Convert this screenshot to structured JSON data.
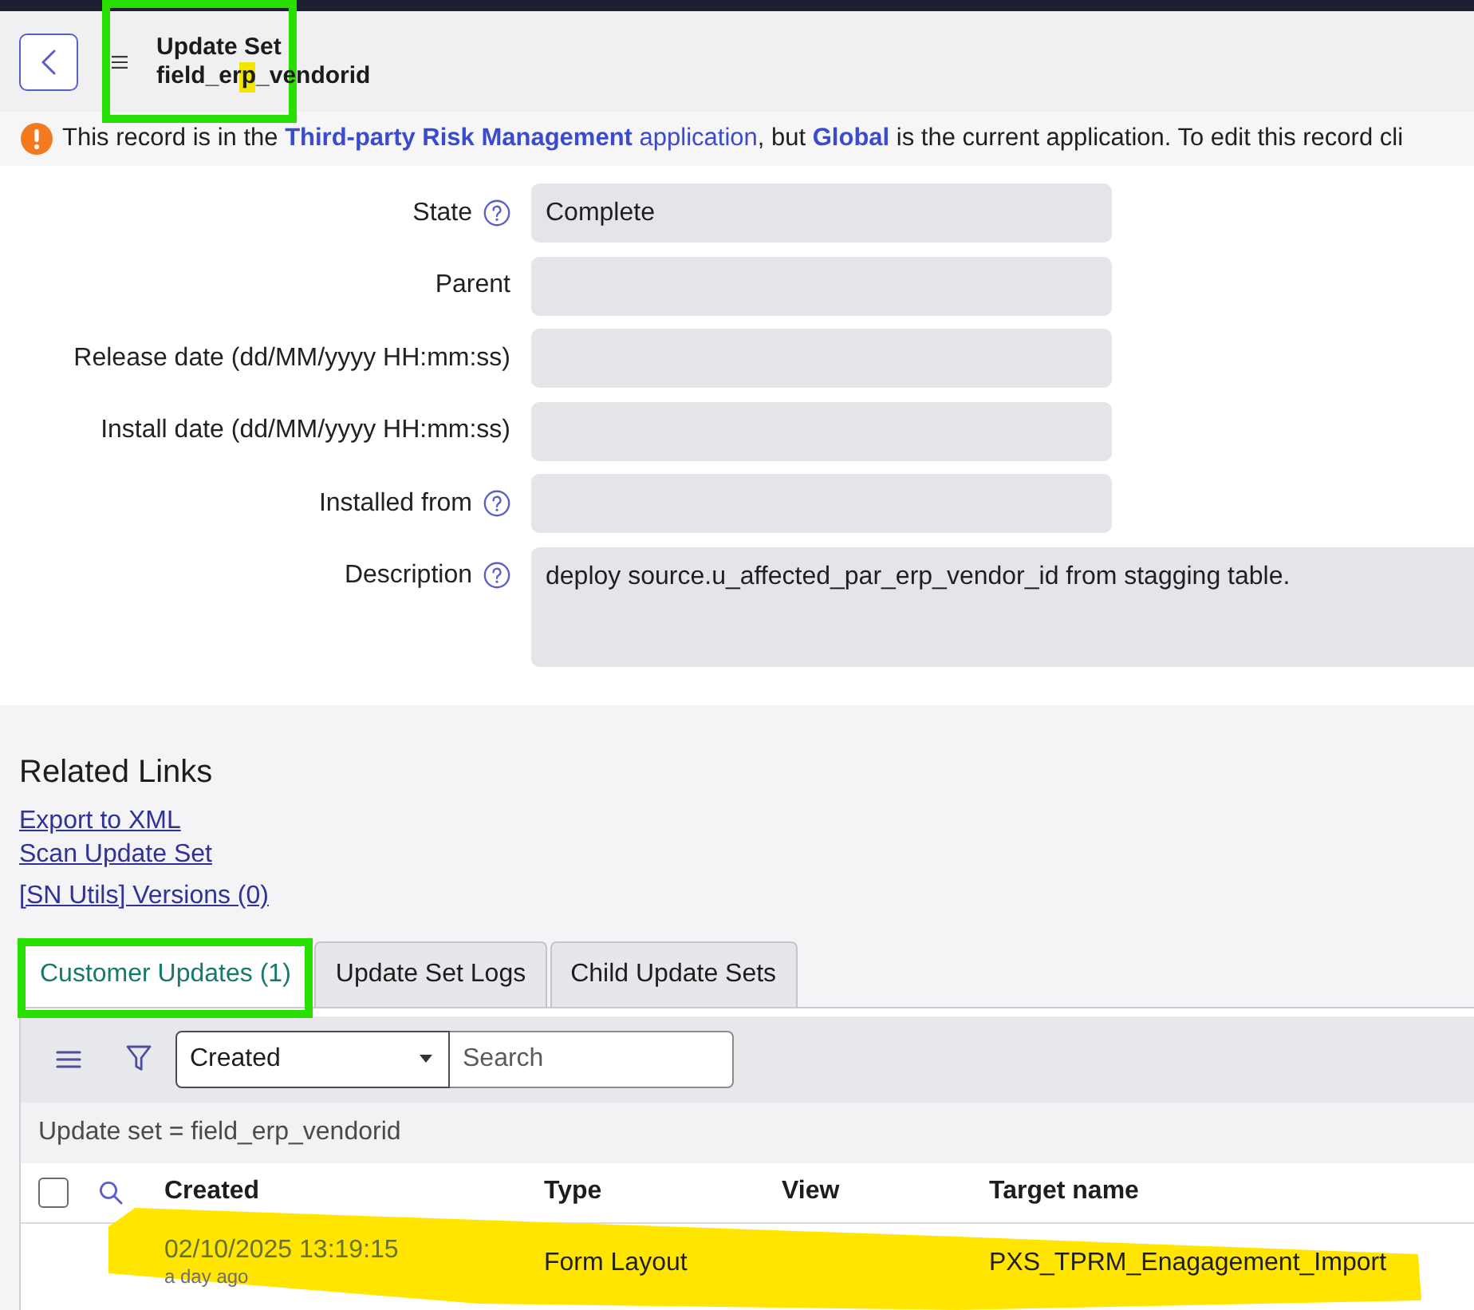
{
  "header": {
    "title": "Update Set",
    "subtitle": "field_erp_vendorid",
    "boxed": true,
    "marked": true
  },
  "notice": {
    "parts": [
      {
        "kind": "text",
        "text": "This record is in the "
      },
      {
        "kind": "link",
        "text": "**Third-party Risk Management** application",
        "strong": false
      },
      {
        "kind": "text",
        "text": ", but "
      },
      {
        "kind": "link",
        "text": "Global",
        "strong": true
      },
      {
        "kind": "text",
        "text": " is the current application. To edit this record cli"
      }
    ]
  },
  "form": {
    "fields": [
      {
        "label": "State",
        "help": true,
        "kind": "input",
        "value": "Complete"
      },
      {
        "label": "Parent",
        "help": false,
        "kind": "input"
      },
      {
        "label": "Release date (dd/MM/yyyy HH:mm:ss)",
        "help": false,
        "kind": "input"
      },
      {
        "label": "Install date (dd/MM/yyyy HH:mm:ss)",
        "help": false,
        "kind": "input"
      },
      {
        "label": "Installed from",
        "help": true,
        "kind": "input"
      },
      {
        "label": "Description",
        "help": true,
        "kind": "textarea",
        "value": "deploy source.u_affected_par_erp_vendor_id from stagging table."
      }
    ]
  },
  "related_links": {
    "title": "Related Links",
    "links": [
      "Export to XML",
      "Scan Update Set",
      "[SN Utils] Versions (0)"
    ]
  },
  "tabs": [
    {
      "label": "Customer Updates (1)",
      "selected": true,
      "boxed": true
    },
    {
      "label": "Update Set Logs",
      "selected": false,
      "boxed": false
    },
    {
      "label": "Child Update Sets",
      "selected": false,
      "boxed": false
    }
  ],
  "list": {
    "field_select": {
      "value": "Created"
    },
    "search": {
      "placeholder": "Search"
    },
    "breadcrumb": "Update set = field_erp_vendorid",
    "select_all": {
      "checked": false
    },
    "columns": [
      "Created",
      "Type",
      "View",
      "Target name"
    ],
    "rows": [
      {
        "created": "02/10/2025 13:19:15",
        "created_relative": "a day ago",
        "type": "Form Layout",
        "target_name": "PXS_TPRM_Enagagement_Import",
        "highlighted": true
      }
    ]
  }
}
